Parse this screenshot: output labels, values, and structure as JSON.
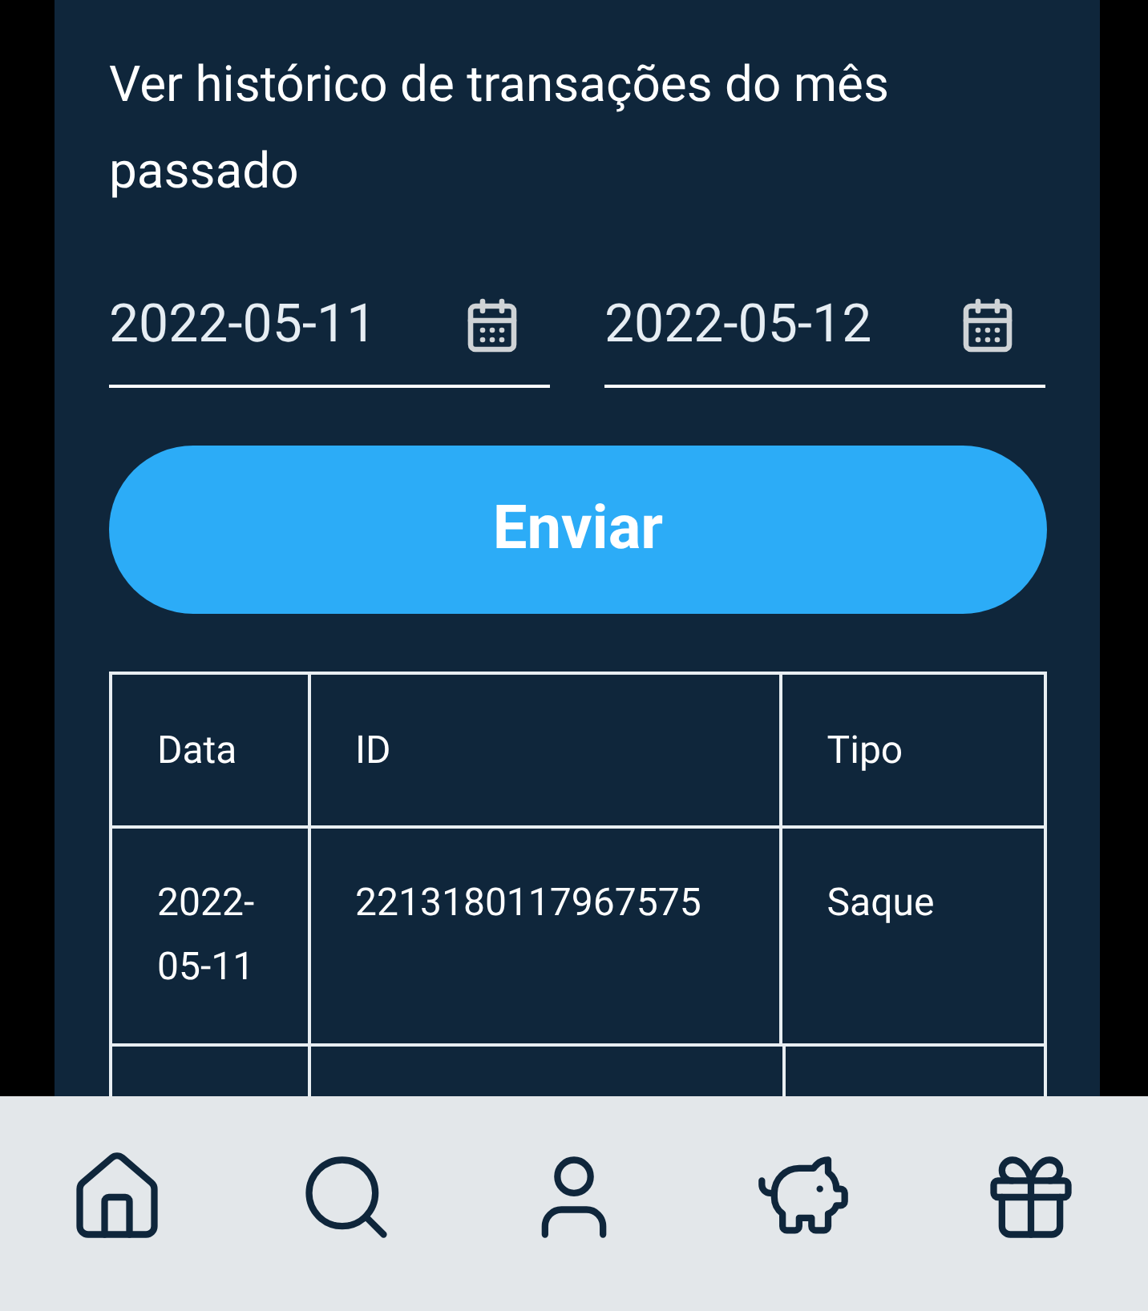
{
  "title": "Ver histórico de transações do mês passado",
  "date_fields": [
    {
      "value": "2022-05-11"
    },
    {
      "value": "2022-05-12"
    }
  ],
  "submit_button": "Enviar",
  "table": {
    "columns": [
      "Data",
      "ID",
      "Tipo"
    ],
    "rows": [
      [
        "2022-05-11",
        "2213180117967575",
        "Saque"
      ]
    ]
  },
  "bottom_nav": [
    {
      "kind": "home"
    },
    {
      "kind": "search"
    },
    {
      "kind": "profile"
    },
    {
      "kind": "savings"
    },
    {
      "kind": "gift"
    }
  ]
}
